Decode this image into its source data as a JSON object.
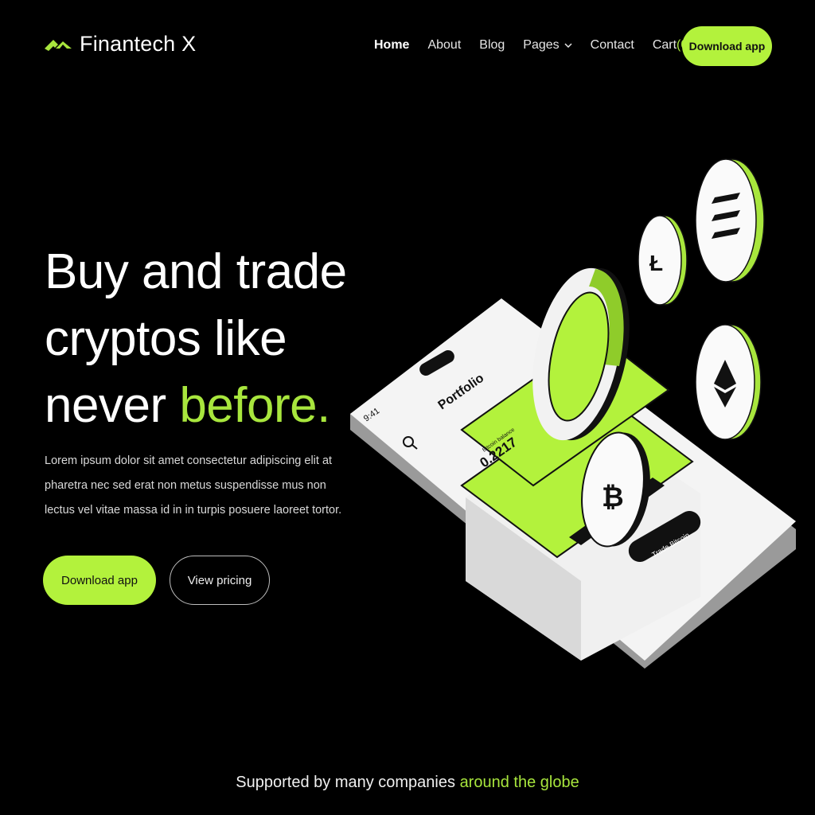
{
  "header": {
    "brand": "Finantech X",
    "nav": {
      "home": "Home",
      "about": "About",
      "blog": "Blog",
      "pages": "Pages",
      "contact": "Contact",
      "cart_label": "Cart",
      "cart_count": "(0)"
    },
    "download_label": "Download app"
  },
  "hero": {
    "title_line1": "Buy and trade",
    "title_line2": "cryptos like",
    "title_line3_start": "never ",
    "title_line3_accent": "before.",
    "desc_line1": "Lorem ipsum dolor sit amet consectetur adipiscing elit at",
    "desc_line2": "pharetra nec sed erat non metus suspendisse mus non",
    "desc_line3": "lectus vel vitae massa id in in turpis posuere laoreet tortor.",
    "primary_button": "Download app",
    "secondary_button": "View pricing"
  },
  "illustration": {
    "phone_time": "9:41",
    "phone_title": "Portfolio",
    "balance_label": "Bitcoin balance",
    "balance_value": "0.2217",
    "trade_button": "Trade Bitcoin"
  },
  "footer_strip": {
    "text": "Supported by many companies ",
    "accent": "around the globe"
  },
  "colors": {
    "accent": "#b3f23c",
    "background": "#000000",
    "text": "#ffffff"
  },
  "icons": [
    "logo-mark-icon",
    "chevron-down-icon",
    "search-icon",
    "litecoin-icon",
    "solana-icon",
    "ethereum-icon",
    "bitcoin-icon"
  ]
}
